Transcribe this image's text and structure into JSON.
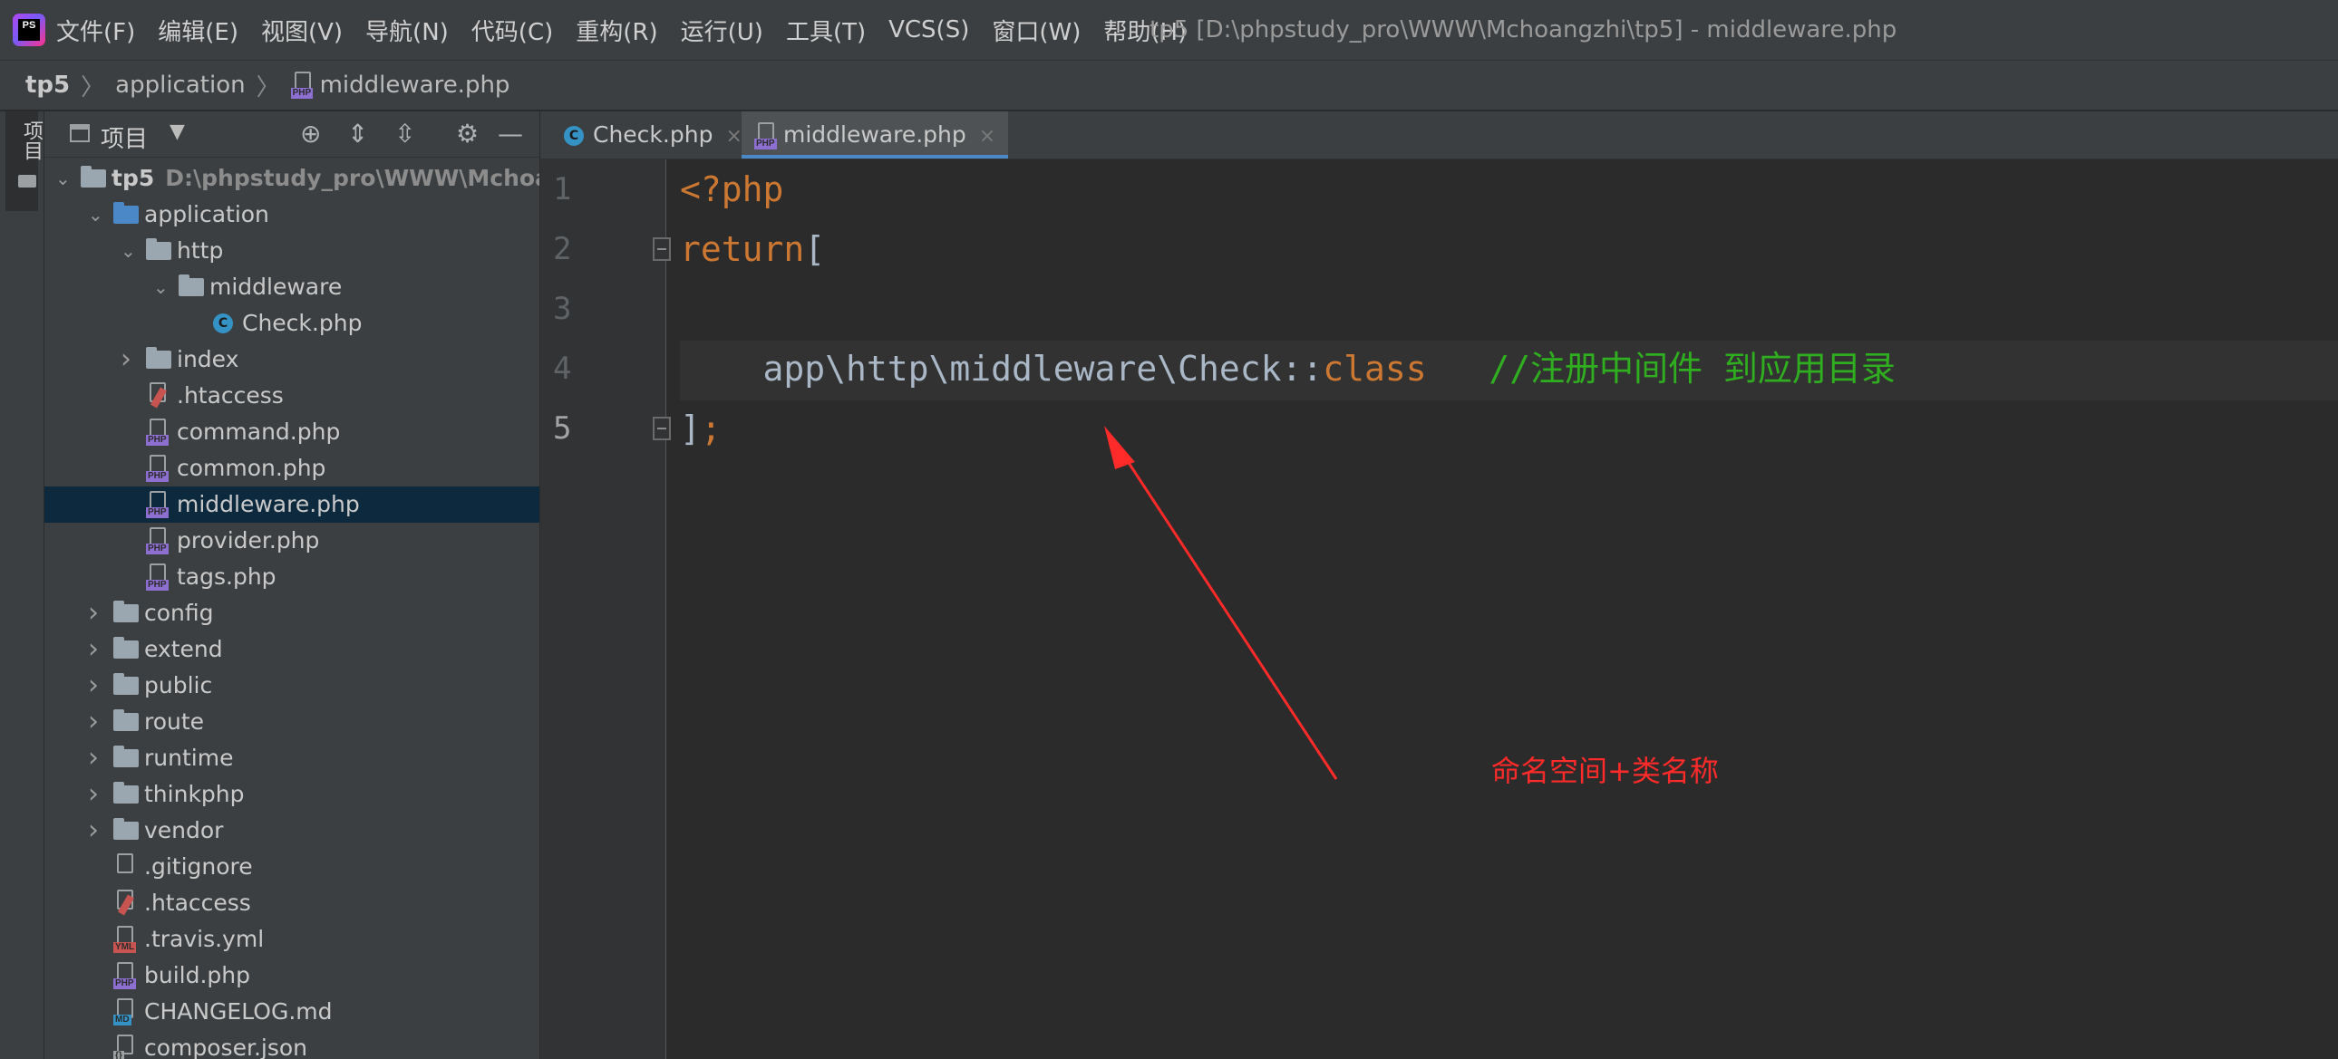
{
  "app": {
    "logo_text": "PS",
    "window_title": "tp5 [D:\\phpstudy_pro\\WWW\\Mchoangzhi\\tp5] - middleware.php"
  },
  "menu": [
    {
      "label": "文件(F)"
    },
    {
      "label": "编辑(E)"
    },
    {
      "label": "视图(V)"
    },
    {
      "label": "导航(N)"
    },
    {
      "label": "代码(C)"
    },
    {
      "label": "重构(R)"
    },
    {
      "label": "运行(U)"
    },
    {
      "label": "工具(T)"
    },
    {
      "label": "VCS(S)"
    },
    {
      "label": "窗口(W)"
    },
    {
      "label": "帮助(H)"
    }
  ],
  "breadcrumb": {
    "root": "tp5",
    "folder": "application",
    "file": "middleware.php"
  },
  "tool_strip": {
    "label": "项目"
  },
  "project_panel": {
    "title": "项目",
    "dropdown_icon": "caret-down-icon",
    "buttons": [
      "locate-icon",
      "expand-all-icon",
      "collapse-all-icon",
      "gear-icon",
      "minimize-icon"
    ]
  },
  "tree": [
    {
      "label": "tp5",
      "path": "D:\\phpstudy_pro\\WWW\\Mchoangzhi",
      "kind": "folder",
      "depth": 0,
      "expanded": true
    },
    {
      "label": "application",
      "kind": "folder-blue",
      "depth": 1,
      "expanded": true
    },
    {
      "label": "http",
      "kind": "folder",
      "depth": 2,
      "expanded": true
    },
    {
      "label": "middleware",
      "kind": "folder",
      "depth": 3,
      "expanded": true
    },
    {
      "label": "Check.php",
      "kind": "class",
      "depth": 4
    },
    {
      "label": "index",
      "kind": "folder",
      "depth": 2,
      "expanded": false
    },
    {
      "label": ".htaccess",
      "kind": "htaccess",
      "depth": 2
    },
    {
      "label": "command.php",
      "kind": "php",
      "depth": 2
    },
    {
      "label": "common.php",
      "kind": "php",
      "depth": 2
    },
    {
      "label": "middleware.php",
      "kind": "php",
      "depth": 2,
      "selected": true
    },
    {
      "label": "provider.php",
      "kind": "php",
      "depth": 2
    },
    {
      "label": "tags.php",
      "kind": "php",
      "depth": 2
    },
    {
      "label": "config",
      "kind": "folder",
      "depth": 1,
      "expanded": false
    },
    {
      "label": "extend",
      "kind": "folder",
      "depth": 1,
      "expanded": false
    },
    {
      "label": "public",
      "kind": "folder",
      "depth": 1,
      "expanded": false
    },
    {
      "label": "route",
      "kind": "folder",
      "depth": 1,
      "expanded": false
    },
    {
      "label": "runtime",
      "kind": "folder",
      "depth": 1,
      "expanded": false
    },
    {
      "label": "thinkphp",
      "kind": "folder",
      "depth": 1,
      "expanded": false
    },
    {
      "label": "vendor",
      "kind": "folder",
      "depth": 1,
      "expanded": false
    },
    {
      "label": ".gitignore",
      "kind": "plain",
      "depth": 1
    },
    {
      "label": ".htaccess",
      "kind": "htaccess",
      "depth": 1
    },
    {
      "label": ".travis.yml",
      "kind": "yml",
      "depth": 1
    },
    {
      "label": "build.php",
      "kind": "php",
      "depth": 1
    },
    {
      "label": "CHANGELOG.md",
      "kind": "md",
      "depth": 1
    },
    {
      "label": "composer.json",
      "kind": "json",
      "depth": 1
    }
  ],
  "editor_tabs": [
    {
      "label": "Check.php",
      "icon": "class-icon",
      "active": false
    },
    {
      "label": "middleware.php",
      "icon": "php-file-icon",
      "active": true
    }
  ],
  "code": {
    "line_numbers": [
      "1",
      "2",
      "3",
      "4",
      "5"
    ],
    "line1": "<?php",
    "line2_kw": "return",
    "line2_txt": "[",
    "line4_txt": "    app\\http\\middleware\\Check::",
    "line4_kw": "class",
    "line4_comment": "   //注册中间件 到应用目录",
    "line5_txt": "]",
    "line5_kw": ";"
  },
  "annotation": {
    "text": "命名空间+类名称",
    "color": "#ff2a2a"
  },
  "colors": {
    "keyword": "#cc7832",
    "text": "#a9b7c6",
    "comment": "#2fae1f",
    "selection": "#0d293e",
    "accent": "#4a88c7"
  }
}
